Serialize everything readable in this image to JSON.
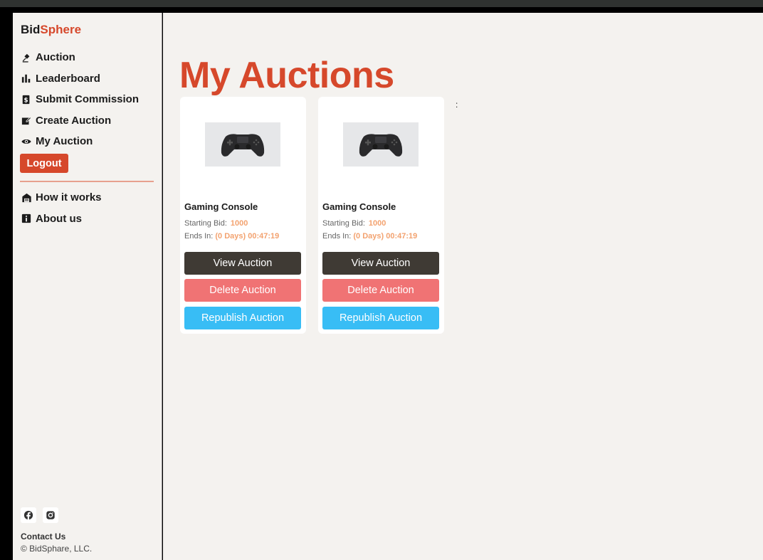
{
  "brand": {
    "part1": "Bid",
    "part2": "Sphere"
  },
  "sidebar": {
    "nav": [
      {
        "label": "Auction",
        "icon": "gavel-icon"
      },
      {
        "label": "Leaderboard",
        "icon": "bar-chart-icon"
      },
      {
        "label": "Submit Commission",
        "icon": "receipt-icon"
      },
      {
        "label": "Create Auction",
        "icon": "edit-icon"
      },
      {
        "label": "My Auction",
        "icon": "eye-icon"
      }
    ],
    "logout_label": "Logout",
    "secondary_nav": [
      {
        "label": "How it works",
        "icon": "garage-icon"
      },
      {
        "label": "About us",
        "icon": "info-icon"
      }
    ],
    "social": [
      "facebook-icon",
      "instagram-icon"
    ],
    "contact_label": "Contact Us",
    "copyright": "© BidSphare, LLC."
  },
  "main": {
    "title": "My Auctions",
    "colon": ":",
    "cards": [
      {
        "title": "Gaming Console",
        "starting_bid_label": "Starting Bid:",
        "starting_bid": "1000",
        "ends_in_label": "Ends In:",
        "ends_in": "(0 Days) 00:47:19",
        "view_label": "View Auction",
        "delete_label": "Delete Auction",
        "republish_label": "Republish Auction",
        "image": "game-controller-image"
      },
      {
        "title": "Gaming Console",
        "starting_bid_label": "Starting Bid:",
        "starting_bid": "1000",
        "ends_in_label": "Ends In:",
        "ends_in": "(0 Days) 00:47:19",
        "view_label": "View Auction",
        "delete_label": "Delete Auction",
        "republish_label": "Republish Auction",
        "image": "game-controller-image"
      }
    ]
  },
  "colors": {
    "accent": "#d6482b",
    "view_button": "#3f3a34",
    "delete_button": "#f07374",
    "republish_button": "#38bdf5",
    "value_text": "#f3a26f"
  }
}
